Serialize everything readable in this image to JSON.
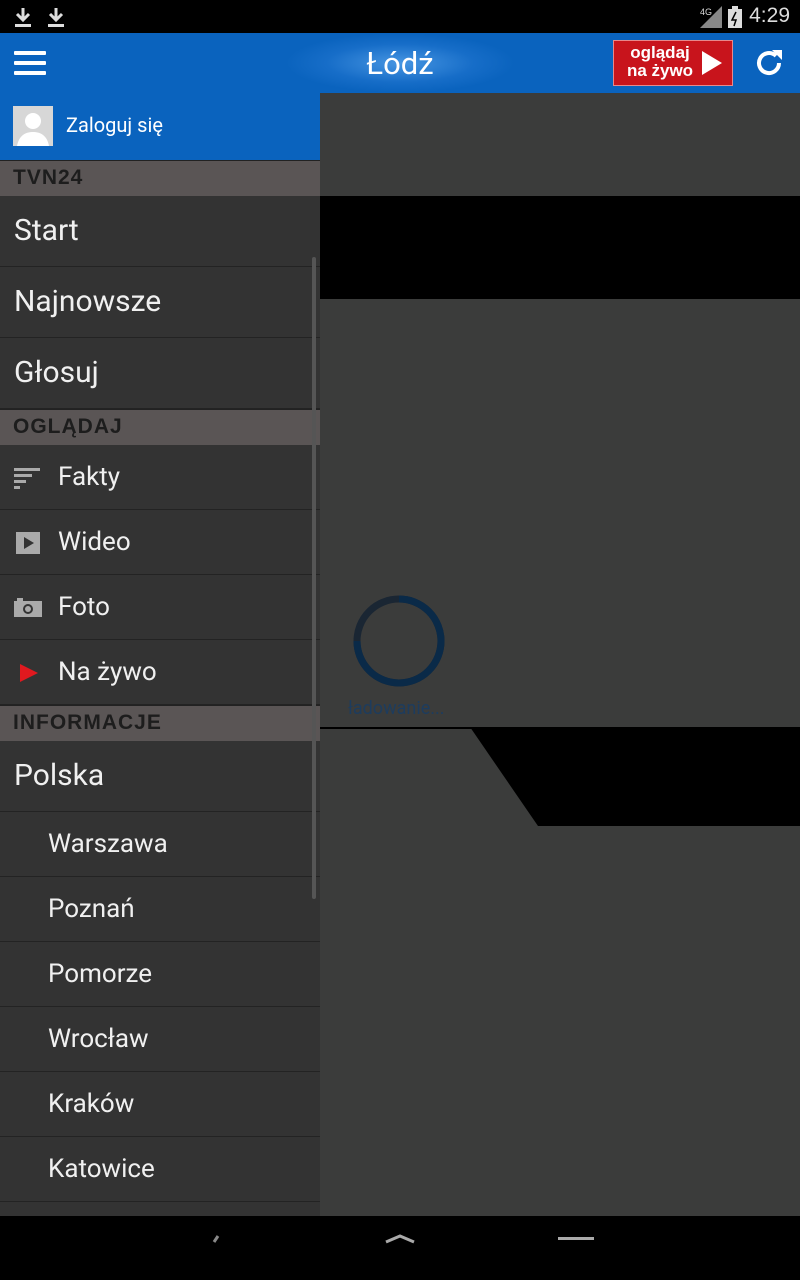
{
  "status_bar": {
    "time": "4:29",
    "network": "4G"
  },
  "app_bar": {
    "title": "Łódź",
    "live_button_label": "oglądaj na żywo"
  },
  "drawer": {
    "login_label": "Zaloguj się",
    "sections": [
      {
        "label": "TVN24",
        "items": [
          "Start",
          "Najnowsze",
          "Głosuj"
        ]
      },
      {
        "label": "OGLĄDAJ",
        "items": [
          "Fakty",
          "Wideo",
          "Foto",
          "Na żywo"
        ]
      },
      {
        "label": "INFORMACJE",
        "items": [
          "Polska"
        ],
        "subitems": [
          "Warszawa",
          "Poznań",
          "Pomorze",
          "Wrocław",
          "Kraków",
          "Katowice"
        ]
      }
    ]
  },
  "content": {
    "loading_text": "ładowanie..."
  },
  "colors": {
    "app_bar": "#0a63be",
    "live_button": "#c8141c",
    "drawer_bg": "#333333",
    "section_bg": "#5a5555"
  }
}
